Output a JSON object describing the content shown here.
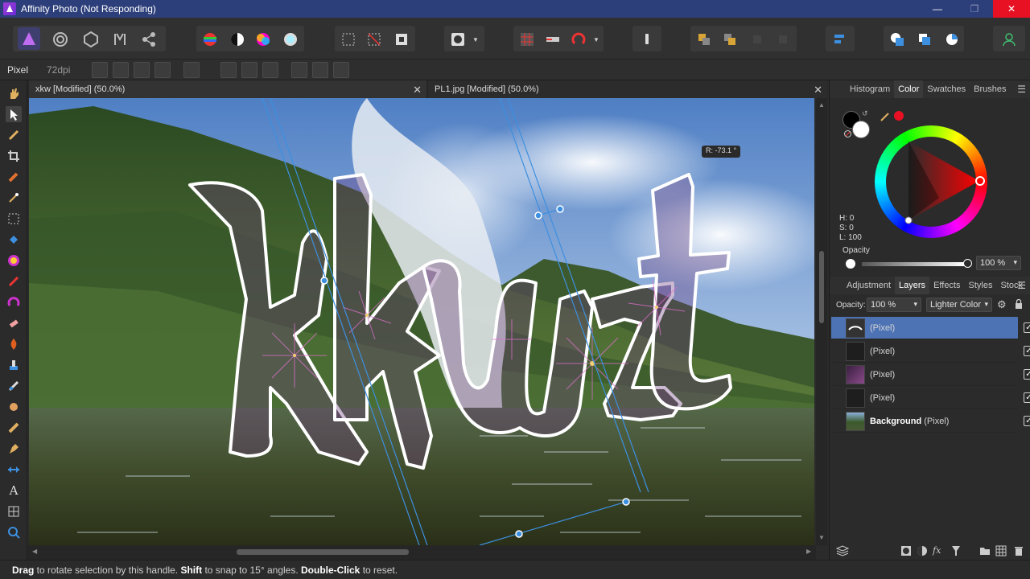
{
  "window": {
    "title": "Affinity Photo (Not Responding)",
    "minimize": "—",
    "maximize": "❐",
    "close": "✕"
  },
  "context_bar": {
    "tool_label": "Pixel",
    "dpi": "72dpi"
  },
  "documents": {
    "tabs": [
      {
        "label": "xkw [Modified] (50.0%)",
        "active": true
      },
      {
        "label": "PL1.jpg [Modified] (50.0%)",
        "active": false
      }
    ],
    "close_glyph": "✕"
  },
  "canvas": {
    "artwork_text": "Kkuzt",
    "rotation_readout": "R: -73.1 °"
  },
  "right_panel": {
    "top_tabs": [
      "Histogram",
      "Color",
      "Swatches",
      "Brushes"
    ],
    "top_active": "Color",
    "hsl": {
      "h": "H: 0",
      "s": "S: 0",
      "l": "L: 100"
    },
    "opacity_label": "Opacity",
    "opacity_value": "100 %",
    "accent_color": "#e81123",
    "layer_tabs": [
      "Adjustment",
      "Layers",
      "Effects",
      "Styles",
      "Stock"
    ],
    "layer_active": "Layers",
    "layer_opacity_label": "Opacity:",
    "layer_opacity_value": "100 %",
    "blend_mode": "Lighter Color",
    "layers": [
      {
        "name": "(Pixel)",
        "bold": "",
        "selected": true,
        "checked": true
      },
      {
        "name": "(Pixel)",
        "bold": "",
        "selected": false,
        "checked": true
      },
      {
        "name": "(Pixel)",
        "bold": "",
        "selected": false,
        "checked": true
      },
      {
        "name": "(Pixel)",
        "bold": "",
        "selected": false,
        "checked": true
      },
      {
        "name": "(Pixel)",
        "bold": "Background",
        "selected": false,
        "checked": true
      }
    ]
  },
  "status_bar": {
    "drag_key": "Drag",
    "drag_text": " to rotate selection by this handle. ",
    "shift_key": "Shift",
    "shift_text": " to snap to 15° angles. ",
    "dbl_key": "Double-Click",
    "dbl_text": " to reset."
  }
}
